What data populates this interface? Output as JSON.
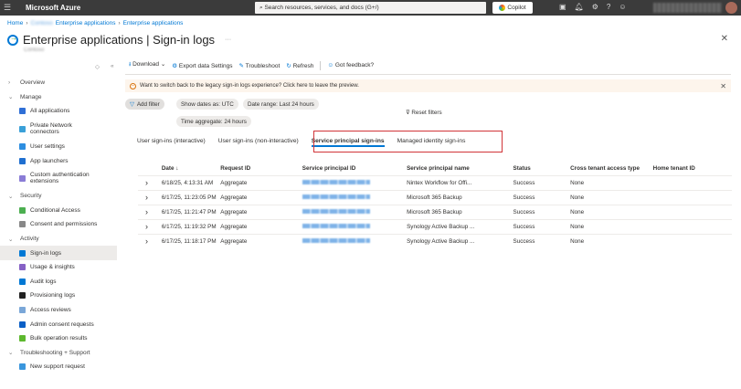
{
  "topbar": {
    "brand": "Microsoft Azure",
    "search_placeholder": "Search resources, services, and docs (G+/)",
    "copilot": "Copilot"
  },
  "breadcrumb": [
    "Home",
    "Enterprise applications",
    "Enterprise applications"
  ],
  "breadcrumb_tenant": "Contoso",
  "page": {
    "title": "Enterprise applications | Sign-in logs",
    "subtitle": "Contoso"
  },
  "sidebar": [
    {
      "label": "Overview",
      "type": "group",
      "collapsed": true
    },
    {
      "label": "Manage",
      "type": "group"
    },
    {
      "label": "All applications",
      "color": "#2f6fd6"
    },
    {
      "label": "Private Network connectors",
      "color": "#3aa0d8",
      "tall": true
    },
    {
      "label": "User settings",
      "color": "#2d8ee0"
    },
    {
      "label": "App launchers",
      "color": "#1f6fd0"
    },
    {
      "label": "Custom authentication extensions",
      "color": "#8a7cd6",
      "tall": true
    },
    {
      "label": "Security",
      "type": "group"
    },
    {
      "label": "Conditional Access",
      "color": "#4caf50"
    },
    {
      "label": "Consent and permissions",
      "color": "#888888"
    },
    {
      "label": "Activity",
      "type": "group"
    },
    {
      "label": "Sign-in logs",
      "color": "#0078d4",
      "selected": true
    },
    {
      "label": "Usage & insights",
      "color": "#8661c5"
    },
    {
      "label": "Audit logs",
      "color": "#0078d4"
    },
    {
      "label": "Provisioning logs",
      "color": "#222222"
    },
    {
      "label": "Access reviews",
      "color": "#7aa7d8"
    },
    {
      "label": "Admin consent requests",
      "color": "#0a5fc6"
    },
    {
      "label": "Bulk operation results",
      "color": "#5db82e"
    },
    {
      "label": "Troubleshooting + Support",
      "type": "group"
    },
    {
      "label": "New support request",
      "color": "#3a96dd"
    }
  ],
  "toolbar": {
    "download": "Download",
    "export": "Export data Settings",
    "troubleshoot": "Troubleshoot",
    "refresh": "Refresh",
    "feedback": "Got feedback?"
  },
  "banner": "Want to switch back to the legacy sign-in logs experience? Click here to leave the preview.",
  "filters": {
    "add": "Add filter",
    "dates": "Show dates as: UTC",
    "range": "Date range: Last 24 hours",
    "aggregate": "Time aggregate: 24 hours",
    "reset": "Reset filters"
  },
  "tabs": [
    "User sign-ins (interactive)",
    "User sign-ins (non-interactive)",
    "Service principal sign-ins",
    "Managed identity sign-ins"
  ],
  "table": {
    "headers": [
      "Date ↓",
      "Request ID",
      "Service principal ID",
      "Service principal name",
      "Status",
      "Cross tenant access type",
      "Home tenant ID"
    ],
    "rows": [
      [
        "6/18/25, 4:13:31 AM",
        "Aggregate",
        "",
        "Nintex Workflow for Offi...",
        "Success",
        "None",
        ""
      ],
      [
        "6/17/25, 11:23:05 PM",
        "Aggregate",
        "",
        "Microsoft 365 Backup",
        "Success",
        "None",
        ""
      ],
      [
        "6/17/25, 11:21:47 PM",
        "Aggregate",
        "",
        "Microsoft 365 Backup",
        "Success",
        "None",
        ""
      ],
      [
        "6/17/25, 11:19:32 PM",
        "Aggregate",
        "",
        "Synology Active Backup ...",
        "Success",
        "None",
        ""
      ],
      [
        "6/17/25, 11:18:17 PM",
        "Aggregate",
        "",
        "Synology Active Backup ...",
        "Success",
        "None",
        ""
      ]
    ]
  }
}
